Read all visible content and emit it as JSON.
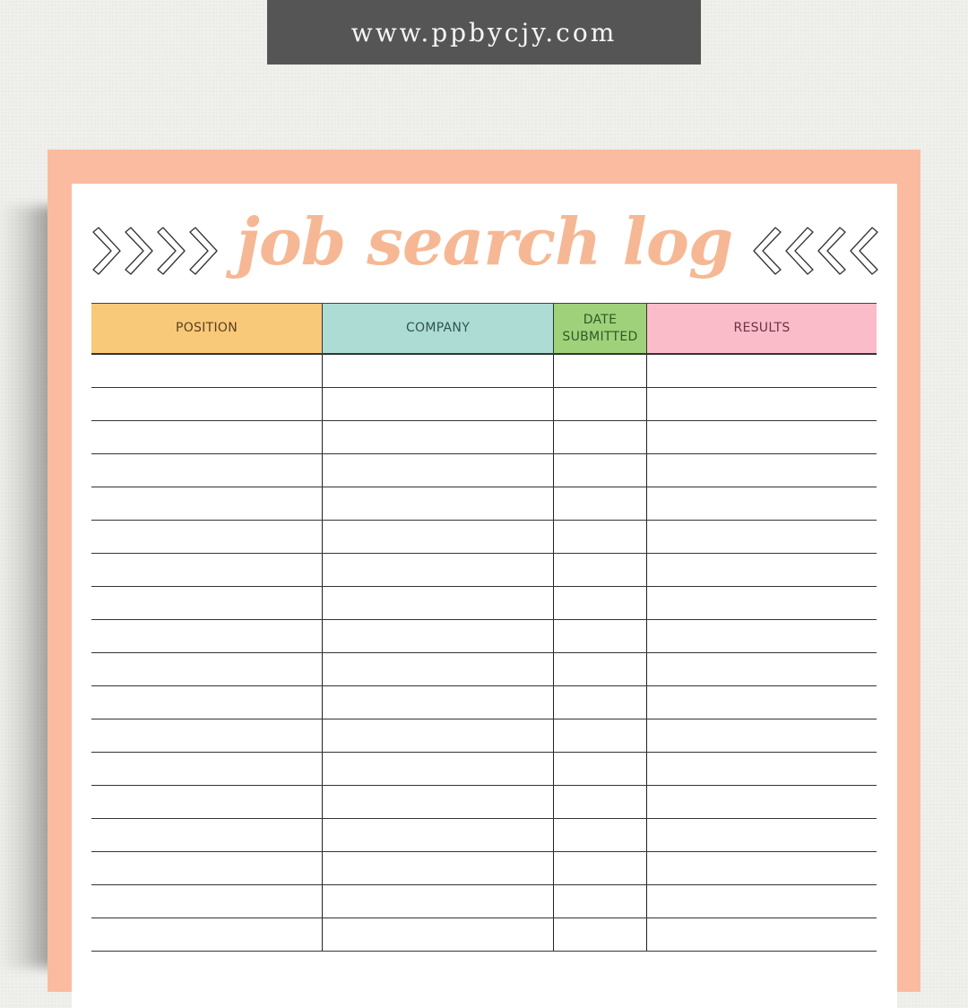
{
  "banner": {
    "text": "www.ppbycjy.com"
  },
  "page": {
    "title": "job search log",
    "left_ornament": "chevron-right-icons",
    "right_ornament": "chevron-left-icons"
  },
  "colors": {
    "frame": "#fbbba0",
    "title": "#f6b894",
    "banner_bg": "#555555",
    "position_header": "#f8c979",
    "company_header": "#acdcd4",
    "date_header": "#9fd17a",
    "results_header": "#fbbcc9"
  },
  "table": {
    "columns": [
      {
        "key": "position",
        "label": "POSITION"
      },
      {
        "key": "company",
        "label": "COMPANY"
      },
      {
        "key": "date_submitted",
        "label": "DATE SUBMITTED",
        "line1": "DATE",
        "line2": "SUBMITTED"
      },
      {
        "key": "results",
        "label": "RESULTS"
      }
    ],
    "rows": [
      [
        "",
        "",
        "",
        ""
      ],
      [
        "",
        "",
        "",
        ""
      ],
      [
        "",
        "",
        "",
        ""
      ],
      [
        "",
        "",
        "",
        ""
      ],
      [
        "",
        "",
        "",
        ""
      ],
      [
        "",
        "",
        "",
        ""
      ],
      [
        "",
        "",
        "",
        ""
      ],
      [
        "",
        "",
        "",
        ""
      ],
      [
        "",
        "",
        "",
        ""
      ],
      [
        "",
        "",
        "",
        ""
      ],
      [
        "",
        "",
        "",
        ""
      ],
      [
        "",
        "",
        "",
        ""
      ],
      [
        "",
        "",
        "",
        ""
      ],
      [
        "",
        "",
        "",
        ""
      ],
      [
        "",
        "",
        "",
        ""
      ],
      [
        "",
        "",
        "",
        ""
      ],
      [
        "",
        "",
        "",
        ""
      ],
      [
        "",
        "",
        "",
        ""
      ]
    ]
  }
}
